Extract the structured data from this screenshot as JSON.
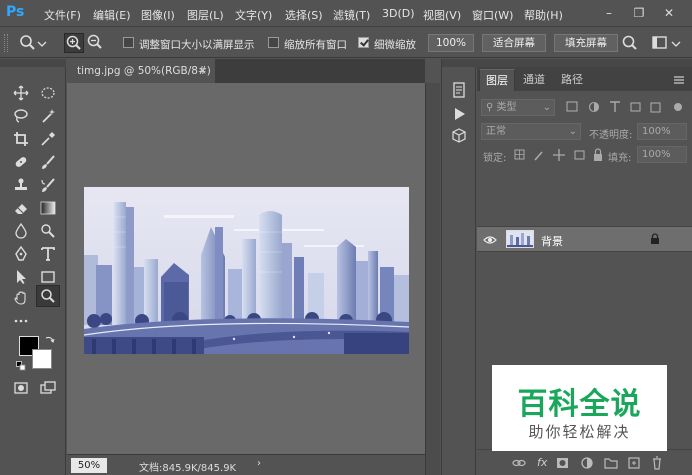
{
  "app": {
    "logo": "Ps"
  },
  "menu": {
    "items": [
      "文件(F)",
      "编辑(E)",
      "图像(I)",
      "图层(L)",
      "文字(Y)",
      "选择(S)",
      "滤镜(T)",
      "3D(D)",
      "视图(V)",
      "窗口(W)",
      "帮助(H)"
    ]
  },
  "options": {
    "resize_windows_label": "调整窗口大小以满屏显示",
    "resize_windows_checked": false,
    "zoom_all_label": "缩放所有窗口",
    "zoom_all_checked": false,
    "scrubby_zoom_label": "细微缩放",
    "scrubby_zoom_checked": true,
    "zoom_100_button": "100%",
    "fit_screen_button": "适合屏幕",
    "fill_screen_button": "填充屏幕"
  },
  "document": {
    "tab_title": "timg.jpg @ 50%(RGB/8#)",
    "tab_close": "×",
    "zoom_value": "50%",
    "info": "文档:845.9K/845.9K",
    "info_arrow": "›"
  },
  "layers_panel": {
    "tabs": [
      "图层",
      "通道",
      "路径"
    ],
    "active_tab": 0,
    "filter_kind": "类型",
    "blend_mode": "正常",
    "opacity_label": "不透明度:",
    "opacity_value": "100%",
    "lock_label": "锁定:",
    "fill_label": "填充:",
    "fill_value": "100%",
    "layers": [
      {
        "name": "背景",
        "visible": true,
        "locked": true
      }
    ],
    "bottom_fx": "fx"
  },
  "watermark": {
    "main": "百科全说",
    "sub": "助你轻松解决",
    "color": "#1aa75b"
  },
  "colors": {
    "foreground": "#000000",
    "background": "#ffffff",
    "ps_blue": "#31a8ff"
  }
}
